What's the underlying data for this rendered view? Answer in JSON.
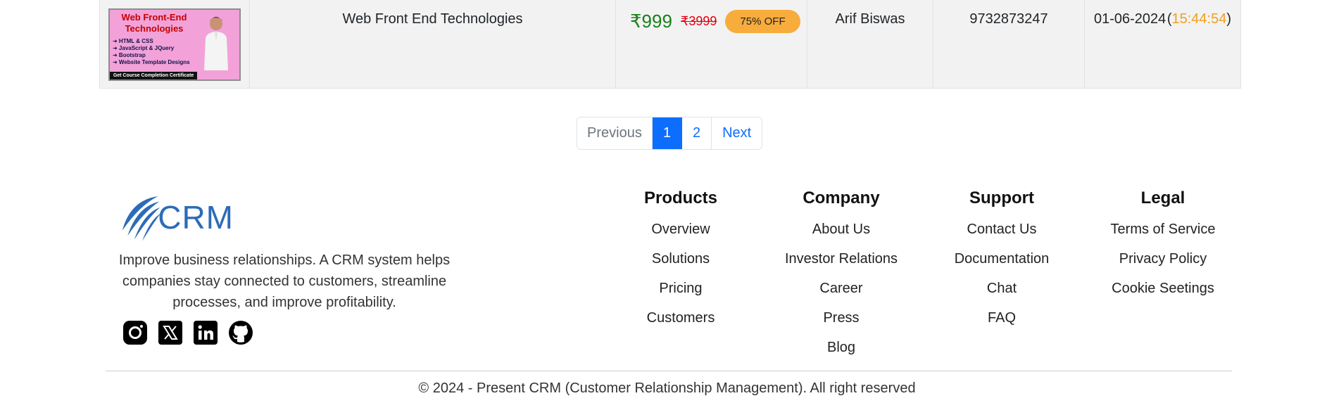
{
  "order": {
    "thumbnail": {
      "title": "Web Front-End Technologies",
      "items": [
        "➜ HTML & CSS",
        "➜ JavaScript & JQuery",
        "➜ Bootstrap",
        "➜ Website Template Designs"
      ],
      "banner": "Get Course Completion Certificate"
    },
    "course_title": "Web Front End Technologies",
    "price": "₹999",
    "original_price": "₹3999",
    "discount": "75% OFF",
    "customer_name": "Arif Biswas",
    "phone": "9732873247",
    "date": "01-06-2024",
    "time": "15:44:54",
    "open_paren": "(",
    "close_paren": ")"
  },
  "pagination": {
    "previous": "Previous",
    "pages": [
      "1",
      "2"
    ],
    "next": "Next",
    "active_page": "1"
  },
  "footer": {
    "logo_text": "CRM",
    "about": "Improve business relationships. A CRM system helps companies stay connected to customers, streamline processes, and improve profitability.",
    "social_icons": [
      "instagram-icon",
      "x-icon",
      "linkedin-icon",
      "github-icon"
    ],
    "columns": [
      {
        "heading": "Products",
        "links": [
          "Overview",
          "Solutions",
          "Pricing",
          "Customers"
        ]
      },
      {
        "heading": "Company",
        "links": [
          "About Us",
          "Investor Relations",
          "Career",
          "Press",
          "Blog"
        ]
      },
      {
        "heading": "Support",
        "links": [
          "Contact Us",
          "Documentation",
          "Chat",
          "FAQ"
        ]
      },
      {
        "heading": "Legal",
        "links": [
          "Terms of Service",
          "Privacy Policy",
          "Cookie Seetings"
        ]
      }
    ],
    "copyright": "© 2024 - Present CRM (Customer Relationship Management). All right reserved"
  },
  "colors": {
    "primary": "#0d6efd",
    "price_green": "#1a7f1a",
    "old_price_red": "#e3000f",
    "discount_badge": "#f7ac3c",
    "time_orange": "#f0a020",
    "logo_blue": "#2b6cb8"
  }
}
